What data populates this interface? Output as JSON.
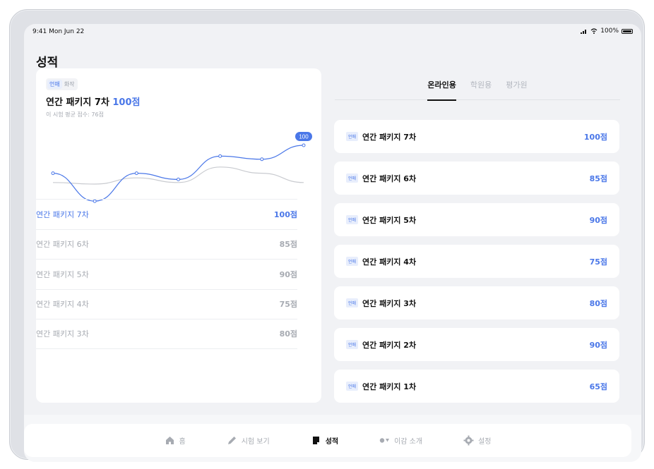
{
  "status": {
    "time": "9:41  Mon Jun 22",
    "battery": "100%"
  },
  "page_title": "성적",
  "left_card": {
    "chips": [
      "언매",
      "화작"
    ],
    "title_prefix": "연간 패키지 7차",
    "title_score": "100점",
    "subtitle": "이 시험 평균 점수: 76점",
    "chart_badge": "100",
    "rows": [
      {
        "name": "연간 패키지 7차",
        "score": "100점"
      },
      {
        "name": "연간 패키지 6차",
        "score": "85점"
      },
      {
        "name": "연간 패키지 5차",
        "score": "90점"
      },
      {
        "name": "연간 패키지 4차",
        "score": "75점"
      },
      {
        "name": "연간 패키지 3차",
        "score": "80점"
      }
    ]
  },
  "tabs": [
    "온라인용",
    "학원용",
    "평가원"
  ],
  "right_list": [
    {
      "badge": "언매",
      "name": "연간 패키지 7차",
      "score": "100점"
    },
    {
      "badge": "언매",
      "name": "연간 패키지 6차",
      "score": "85점"
    },
    {
      "badge": "언매",
      "name": "연간 패키지 5차",
      "score": "90점"
    },
    {
      "badge": "언매",
      "name": "연간 패키지 4차",
      "score": "75점"
    },
    {
      "badge": "언매",
      "name": "연간 패키지 3차",
      "score": "80점"
    },
    {
      "badge": "언매",
      "name": "연간 패키지 2차",
      "score": "90점"
    },
    {
      "badge": "언매",
      "name": "연간 패키지 1차",
      "score": "65점"
    }
  ],
  "nav": [
    {
      "label": "홈",
      "icon": "home-icon"
    },
    {
      "label": "시험 보기",
      "icon": "pencil-icon"
    },
    {
      "label": "성적",
      "icon": "report-icon"
    },
    {
      "label": "이감 소개",
      "icon": "info-icon"
    },
    {
      "label": "설정",
      "icon": "gear-icon"
    }
  ],
  "colors": {
    "accent": "#4a77e8",
    "muted": "#a7abb2",
    "avg_line": "#c9cbd0"
  },
  "chart_data": {
    "type": "line",
    "series": [
      {
        "values": [
          82,
          64,
          82,
          78,
          93,
          91,
          100
        ],
        "color": "#4a77e8"
      },
      {
        "values": [
          76,
          75,
          79,
          76,
          86,
          82,
          76
        ],
        "color": "#c9cbd0"
      }
    ],
    "ylim": [
      55,
      105
    ]
  }
}
